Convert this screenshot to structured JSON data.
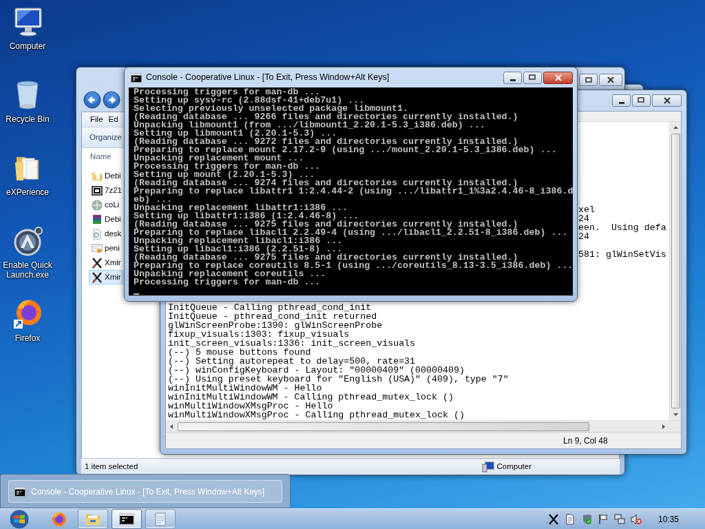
{
  "desktop_icons": [
    {
      "label": "Computer",
      "kind": "computer"
    },
    {
      "label": "Recycle Bin",
      "kind": "trash"
    },
    {
      "label": "eXPerience",
      "kind": "folder"
    },
    {
      "label": "Enable Quick Launch.exe",
      "kind": "launcher"
    },
    {
      "label": "Firefox",
      "kind": "browser"
    }
  ],
  "explorer": {
    "menu": [
      "File",
      "Ed"
    ],
    "toolbar": [
      "Organize"
    ],
    "column": "Name",
    "files": [
      {
        "name": "Debi",
        "kind": "folder",
        "selected": false
      },
      {
        "name": "7z21",
        "kind": "archive",
        "selected": false
      },
      {
        "name": "coLi",
        "kind": "globe",
        "selected": false
      },
      {
        "name": "Debi",
        "kind": "books",
        "selected": false
      },
      {
        "name": "desk",
        "kind": "settings-file",
        "selected": false
      },
      {
        "name": "peni",
        "kind": "certificate",
        "selected": false
      },
      {
        "name": "Xmir",
        "kind": "cross",
        "selected": false
      },
      {
        "name": "Xmir",
        "kind": "cross",
        "selected": true
      }
    ],
    "status": "1 item selected",
    "location": "Computer"
  },
  "log_window": {
    "fragments": [
      "xel",
      "24",
      "een.  Using defa",
      "24",
      "581: glWinSetVis"
    ],
    "lines": [
      "InitQueue - Calling pthread_cond_init",
      "InitQueue - pthread_cond_init returned",
      "glWinScreenProbe:1390: glWinScreenProbe",
      "fixup_visuals:1303: fixup_visuals",
      "init_screen_visuals:1336: init_screen_visuals",
      "(--) 5 mouse buttons found",
      "(--) Setting autorepeat to delay=500, rate=31",
      "(--) winConfigKeyboard - Layout: \"00000409\" (00000409)",
      "(--) Using preset keyboard for \"English (USA)\" (409), type \"7\"",
      "winInitMultiWindowWM - Hello",
      "winInitMultiWindowWM - Calling pthread_mutex_lock ()",
      "winMultiWindowXMsgProc - Hello",
      "winMultiWindowXMsgProc - Calling pthread_mutex_lock ()"
    ],
    "status": "Ln 9, Col 48"
  },
  "console": {
    "title": "Console - Cooperative Linux - [To Exit, Press Window+Alt Keys]",
    "lines": [
      "Processing triggers for man-db ...",
      "Setting up sysv-rc (2.88dsf-41+deb7u1) ...",
      "Selecting previously unselected package libmount1.",
      "(Reading database ... 9266 files and directories currently installed.)",
      "Unpacking libmount1 (from .../libmount1_2.20.1-5.3_i386.deb) ...",
      "Setting up libmount1 (2.20.1-5.3) ...",
      "(Reading database ... 9272 files and directories currently installed.)",
      "Preparing to replace mount 2.17.2-9 (using .../mount_2.20.1-5.3_i386.deb) ...",
      "Unpacking replacement mount ...",
      "Processing triggers for man-db ...",
      "Setting up mount (2.20.1-5.3) ...",
      "(Reading database ... 9274 files and directories currently installed.)",
      "Preparing to replace libattr1 1:2.4.44-2 (using .../libattr1_1%3a2.4.46-8_i386.d",
      "eb) ...",
      "Unpacking replacement libattr1:i386 ...",
      "Setting up libattr1:i386 (1:2.4.46-8) ...",
      "(Reading database ... 9275 files and directories currently installed.)",
      "Preparing to replace libacl1 2.2.49-4 (using .../libacl1_2.2.51-8_i386.deb) ...",
      "Unpacking replacement libacl1:i386 ...",
      "Setting up libacl1:i386 (2.2.51-8) ...",
      "(Reading database ... 9275 files and directories currently installed.)",
      "Preparing to replace coreutils 8.5-1 (using .../coreutils_8.13-3.5_i386.deb) ...",
      "Unpacking replacement coreutils ...",
      "Processing triggers for man-db ..."
    ]
  },
  "taskbar": {
    "preview": "Console - Cooperative Linux - [To Exit, Press Window+Alt Keys]",
    "buttons": [
      {
        "kind": "browser",
        "open": false,
        "active": false
      },
      {
        "kind": "folder",
        "open": true,
        "active": false
      },
      {
        "kind": "console",
        "open": true,
        "active": true
      },
      {
        "kind": "notepad",
        "open": true,
        "active": false
      }
    ],
    "tray": [
      {
        "kind": "cross"
      },
      {
        "kind": "document"
      },
      {
        "kind": "shield"
      },
      {
        "kind": "flag"
      },
      {
        "kind": "network"
      },
      {
        "kind": "speaker-muted"
      }
    ],
    "clock": "10:35"
  }
}
